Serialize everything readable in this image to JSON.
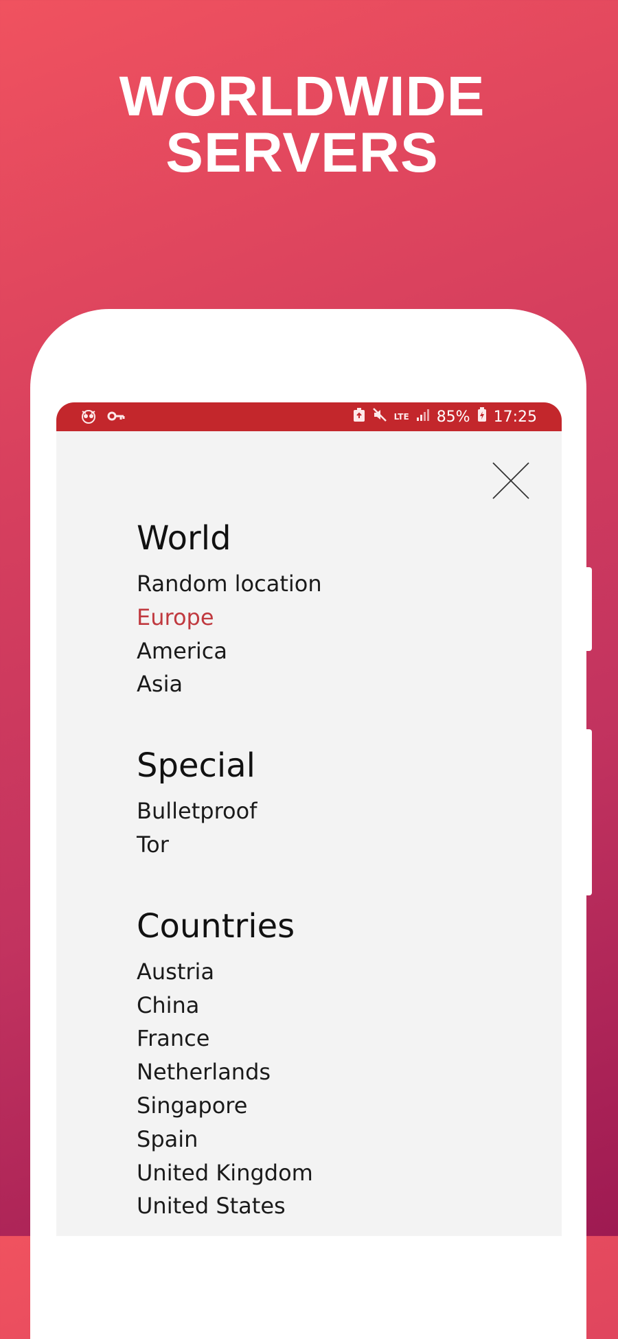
{
  "promo": {
    "title_line1": "WORLDWIDE",
    "title_line2": "SERVERS"
  },
  "status_bar": {
    "left_icons": [
      "incognito-owl-icon",
      "vpn-key-icon"
    ],
    "right_icons": [
      "data-saver-icon",
      "mute-icon",
      "lte-icon",
      "signal-icon",
      "battery-charging-icon"
    ],
    "network_label": "LTE",
    "battery": "85%",
    "time": "17:25",
    "bar_color": "#c3272c"
  },
  "close_button": {
    "icon": "close-icon"
  },
  "sections": [
    {
      "title": "World",
      "items": [
        {
          "label": "Random location",
          "selected": false
        },
        {
          "label": "Europe",
          "selected": true
        },
        {
          "label": "America",
          "selected": false
        },
        {
          "label": "Asia",
          "selected": false
        }
      ]
    },
    {
      "title": "Special",
      "items": [
        {
          "label": "Bulletproof",
          "selected": false
        },
        {
          "label": "Tor",
          "selected": false
        }
      ]
    },
    {
      "title": "Countries",
      "items": [
        {
          "label": "Austria",
          "selected": false
        },
        {
          "label": "China",
          "selected": false
        },
        {
          "label": "France",
          "selected": false
        },
        {
          "label": "Netherlands",
          "selected": false
        },
        {
          "label": "Singapore",
          "selected": false
        },
        {
          "label": "Spain",
          "selected": false
        },
        {
          "label": "United Kingdom",
          "selected": false
        },
        {
          "label": "United States",
          "selected": false
        }
      ]
    }
  ],
  "colors": {
    "accent": "#c0393f",
    "gradient_top": "#f0525f",
    "gradient_bottom": "#9e1a52",
    "screen_bg": "#f3f3f3"
  }
}
